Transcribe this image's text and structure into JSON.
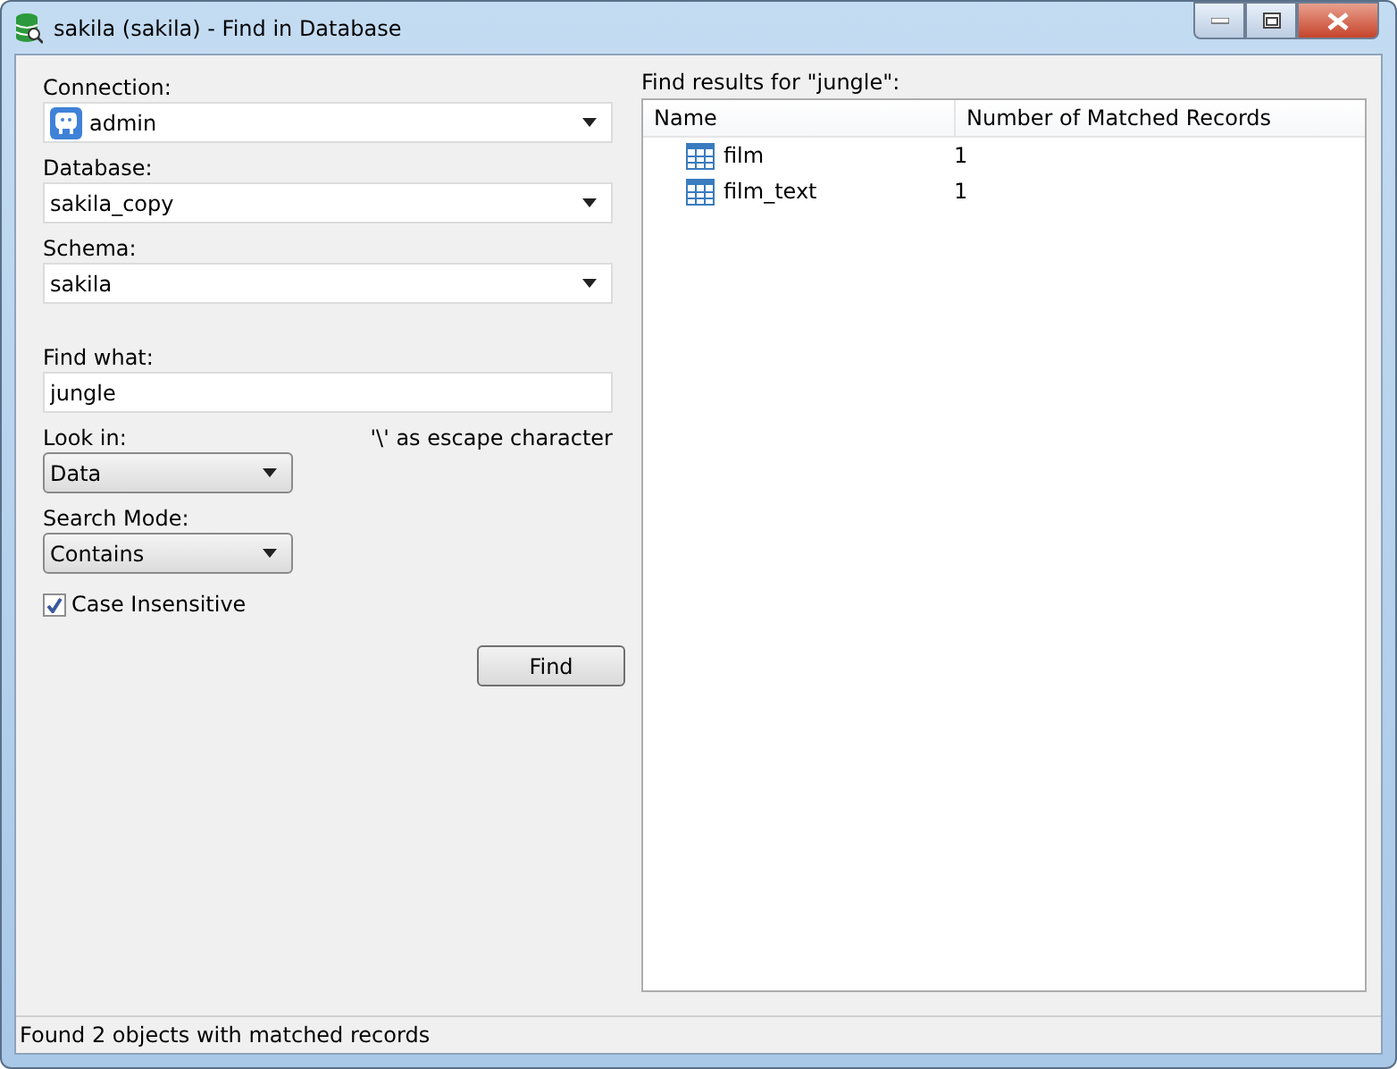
{
  "window": {
    "title": "sakila (sakila) - Find in Database"
  },
  "form": {
    "connection": {
      "label": "Connection:",
      "value": "admin"
    },
    "database": {
      "label": "Database:",
      "value": "sakila_copy"
    },
    "schema": {
      "label": "Schema:",
      "value": "sakila"
    },
    "find_what": {
      "label": "Find what:",
      "value": "jungle"
    },
    "look_in": {
      "label": "Look in:",
      "value": "Data"
    },
    "escape_note": "'\\' as escape character",
    "search_mode": {
      "label": "Search Mode:",
      "value": "Contains"
    },
    "case_insensitive": {
      "label": "Case Insensitive",
      "checked": true
    },
    "find_button": "Find"
  },
  "results": {
    "title": "Find results for \"jungle\":",
    "columns": [
      "Name",
      "Number of Matched Records"
    ],
    "rows": [
      {
        "name": "film",
        "count": "1"
      },
      {
        "name": "film_text",
        "count": "1"
      }
    ]
  },
  "status_bar": "Found 2 objects with matched records"
}
